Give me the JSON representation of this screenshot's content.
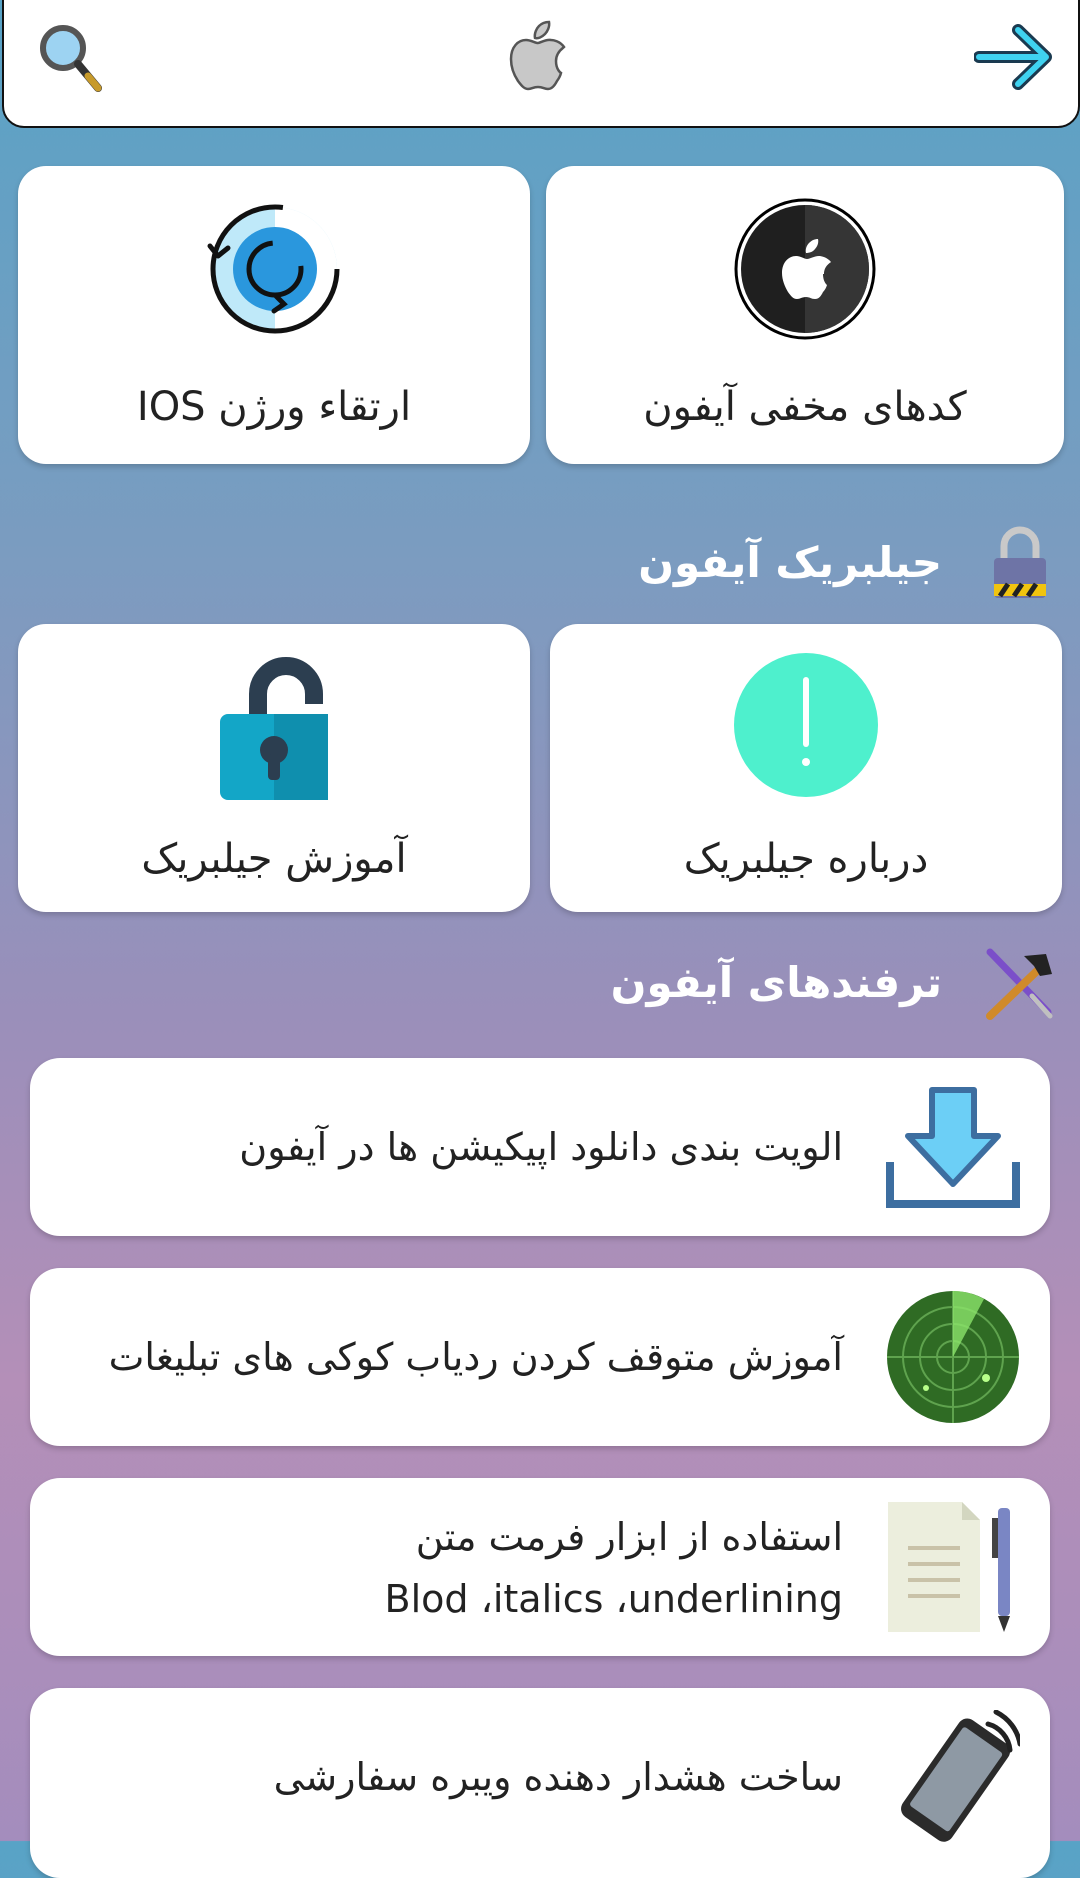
{
  "header": {
    "back_icon": "arrow-right-icon",
    "logo_icon": "apple-logo-icon",
    "search_icon": "search-icon"
  },
  "top_cards": [
    {
      "label": "کدهای مخفی آیفون",
      "icon": "apple-circle-icon"
    },
    {
      "label": "ارتقاء ورژن IOS",
      "icon": "update-sync-icon"
    }
  ],
  "jailbreak_section": {
    "title": "جیلبریک آیفون",
    "icon": "padlock-icon",
    "cards": [
      {
        "label": "درباره جیلبریک",
        "icon": "exclamation-circle-icon"
      },
      {
        "label": "آموزش جیلبریک",
        "icon": "unlocked-padlock-icon"
      }
    ]
  },
  "tricks_section": {
    "title": "ترفندهای آیفون",
    "icon": "hammer-screwdriver-icon",
    "items": [
      {
        "lines": [
          "الویت بندی دانلود اپیکیشن ها در آیفون"
        ],
        "icon": "download-icon"
      },
      {
        "lines": [
          "آموزش متوقف کردن ردیاب کوکی های تبلیغات"
        ],
        "icon": "radar-icon"
      },
      {
        "lines": [
          "استفاده از ابزار فرمت متن",
          "Blod ،italics ،underlining"
        ],
        "icon": "document-pen-icon"
      },
      {
        "lines": [
          "ساخت هشدار دهنده ویبره سفارشی"
        ],
        "icon": "vibrating-phone-icon"
      }
    ]
  },
  "colors": {
    "accent_cyan": "#3fc6e8",
    "mint": "#4ef0cd",
    "teal_lock": "#13a6c7",
    "dark_lock": "#2c3e50"
  }
}
